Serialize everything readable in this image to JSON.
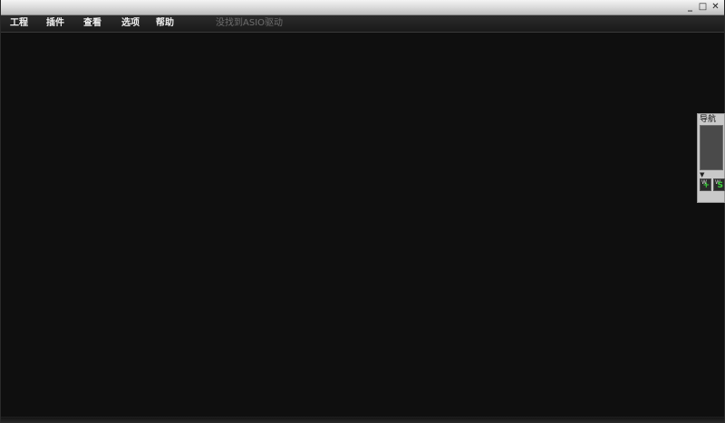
{
  "window": {
    "controls": {
      "minimize": "_",
      "maximize": "□",
      "close": "✕"
    }
  },
  "menu": {
    "items": [
      "工程",
      "插件",
      "查看",
      "选项",
      "帮助"
    ],
    "status": "没找到ASIO驱动"
  },
  "navigator": {
    "title": "导航",
    "arrow": "▼",
    "tools": [
      {
        "prefix": "W",
        "glyph": "+"
      },
      {
        "prefix": "W",
        "glyph": "S"
      }
    ]
  }
}
